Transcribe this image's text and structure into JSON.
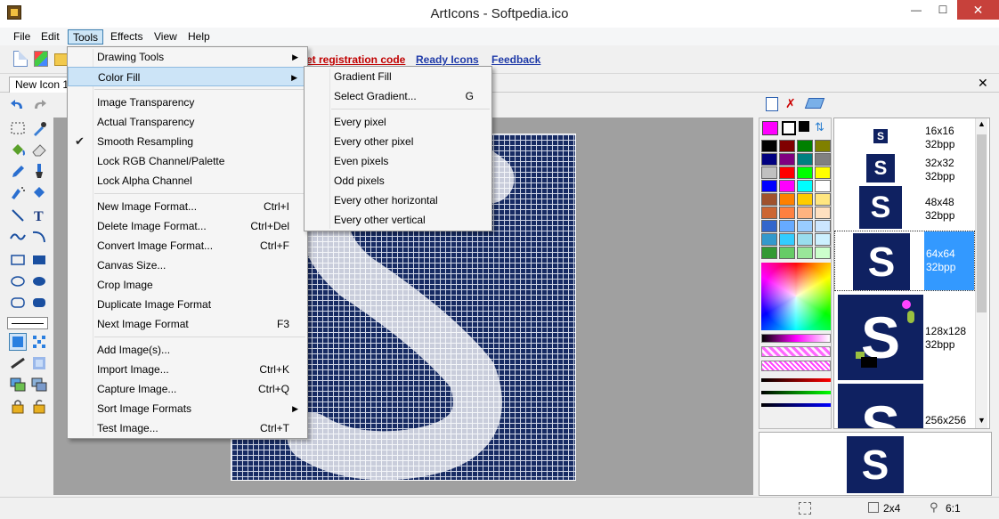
{
  "window": {
    "title": "ArtIcons - Softpedia.ico"
  },
  "menubar": [
    "File",
    "Edit",
    "Tools",
    "Effects",
    "View",
    "Help"
  ],
  "toolbar": {
    "links": {
      "registration": "et registration code",
      "ready_icons": "Ready Icons",
      "feedback": "Feedback"
    }
  },
  "tabs": {
    "doc": "New Icon 1"
  },
  "tools_menu": [
    {
      "label": "Drawing Tools",
      "shortcut": "",
      "submenu": true
    },
    {
      "label": "Color Fill",
      "shortcut": "",
      "submenu": true,
      "highlighted": true
    },
    {
      "label": "Image Transparency",
      "shortcut": ""
    },
    {
      "label": "Actual Transparency",
      "shortcut": ""
    },
    {
      "label": "Smooth Resampling",
      "shortcut": "",
      "checked": true
    },
    {
      "label": "Lock RGB Channel/Palette",
      "shortcut": ""
    },
    {
      "label": "Lock Alpha Channel",
      "shortcut": ""
    },
    {
      "label": "New Image Format...",
      "shortcut": "Ctrl+I"
    },
    {
      "label": "Delete Image Format...",
      "shortcut": "Ctrl+Del"
    },
    {
      "label": "Convert Image Format...",
      "shortcut": "Ctrl+F"
    },
    {
      "label": "Canvas Size...",
      "shortcut": ""
    },
    {
      "label": "Crop Image",
      "shortcut": ""
    },
    {
      "label": "Duplicate Image Format",
      "shortcut": ""
    },
    {
      "label": "Next Image Format",
      "shortcut": "F3"
    },
    {
      "label": "Add  Image(s)...",
      "shortcut": ""
    },
    {
      "label": "Import Image...",
      "shortcut": "Ctrl+K"
    },
    {
      "label": "Capture Image...",
      "shortcut": "Ctrl+Q"
    },
    {
      "label": "Sort Image Formats",
      "shortcut": "",
      "submenu": true
    },
    {
      "label": "Test Image...",
      "shortcut": "Ctrl+T"
    }
  ],
  "color_fill_submenu": [
    {
      "label": "Gradient Fill",
      "shortcut": ""
    },
    {
      "label": "Select Gradient...",
      "shortcut": "G"
    },
    {
      "label": "Every pixel",
      "shortcut": ""
    },
    {
      "label": "Every other pixel",
      "shortcut": ""
    },
    {
      "label": "Even pixels",
      "shortcut": ""
    },
    {
      "label": "Odd pixels",
      "shortcut": ""
    },
    {
      "label": "Every other horizontal",
      "shortcut": ""
    },
    {
      "label": "Every other vertical",
      "shortcut": ""
    }
  ],
  "formats": [
    {
      "size": "16x16",
      "depth": "32bpp"
    },
    {
      "size": "32x32",
      "depth": "32bpp"
    },
    {
      "size": "48x48",
      "depth": "32bpp"
    },
    {
      "size": "64x64",
      "depth": "32bpp",
      "selected": true
    },
    {
      "size": "128x128",
      "depth": "32bpp"
    },
    {
      "size": "256x256",
      "depth": ""
    }
  ],
  "status": {
    "grid": "2x4",
    "zoom": "6:1"
  },
  "colors": {
    "selection": "#3399ff",
    "palette": [
      "#000000",
      "#800000",
      "#008000",
      "#808000",
      "#000080",
      "#800080",
      "#008080",
      "#808080",
      "#c0c0c0",
      "#ff0000",
      "#00ff00",
      "#ffff00",
      "#0000ff",
      "#ff00ff",
      "#00ffff",
      "#ffffff",
      "#a0522d",
      "#ff8000",
      "#ffcc00",
      "#ffe680",
      "#cc6633",
      "#ff8040",
      "#ffb380",
      "#ffe0c0",
      "#3366cc",
      "#66aaff",
      "#99ccff",
      "#cce6ff",
      "#3399cc",
      "#33ccff",
      "#99ddee",
      "#ccf0ff",
      "#339933",
      "#66cc66",
      "#99e699",
      "#ccffcc"
    ]
  }
}
